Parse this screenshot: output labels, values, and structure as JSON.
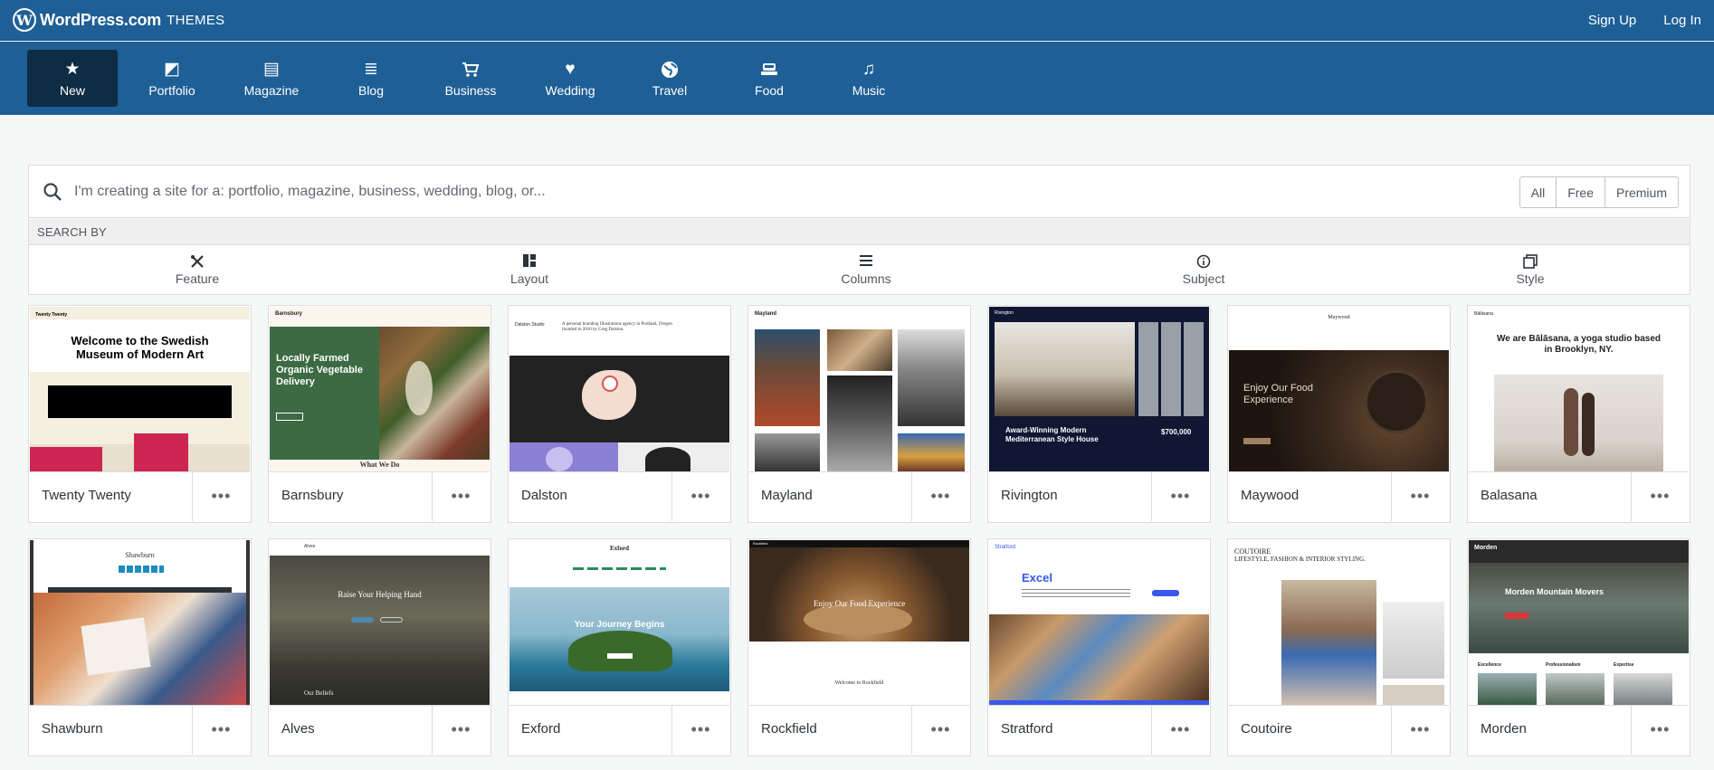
{
  "header": {
    "brand": "WordPress.com",
    "brand_sub": "THEMES",
    "logo_glyph": "W",
    "signup": "Sign Up",
    "login": "Log In"
  },
  "categories": [
    {
      "label": "New",
      "icon": "star-icon",
      "glyph": "★"
    },
    {
      "label": "Portfolio",
      "icon": "portfolio-icon",
      "glyph": "◩"
    },
    {
      "label": "Magazine",
      "icon": "magazine-icon",
      "glyph": "▤"
    },
    {
      "label": "Blog",
      "icon": "blog-icon",
      "glyph": "≣"
    },
    {
      "label": "Business",
      "icon": "cart-icon",
      "glyph": "🛒"
    },
    {
      "label": "Wedding",
      "icon": "heart-icon",
      "glyph": "♥"
    },
    {
      "label": "Travel",
      "icon": "globe-icon",
      "glyph": "◍"
    },
    {
      "label": "Food",
      "icon": "food-icon",
      "glyph": "⊟"
    },
    {
      "label": "Music",
      "icon": "music-icon",
      "glyph": "♫"
    }
  ],
  "search": {
    "placeholder": "I'm creating a site for a: portfolio, magazine, business, wedding, blog, or...",
    "filters": [
      "All",
      "Free",
      "Premium"
    ],
    "search_by_label": "SEARCH BY"
  },
  "facets": [
    {
      "label": "Feature",
      "icon": "tools-icon",
      "glyph": "✕"
    },
    {
      "label": "Layout",
      "icon": "layout-icon",
      "glyph": "▞"
    },
    {
      "label": "Columns",
      "icon": "columns-icon",
      "glyph": "≡"
    },
    {
      "label": "Subject",
      "icon": "info-icon",
      "glyph": "ⓘ"
    },
    {
      "label": "Style",
      "icon": "style-icon",
      "glyph": "⧉"
    }
  ],
  "themes": [
    {
      "name": "Twenty Twenty",
      "headline": "Welcome to the Swedish Museum of Modern Art",
      "site": "Twenty Twenty"
    },
    {
      "name": "Barnsbury",
      "headline": "Locally Farmed Organic Vegetable Delivery",
      "site": "Barnsbury",
      "sub": "What We Do"
    },
    {
      "name": "Dalston",
      "headline": "Dalston Studio",
      "intro": "A personal branding Illustrations agency in Portland, Oregon founded in 2010 by Greg Dalston."
    },
    {
      "name": "Mayland",
      "headline": "Mayland"
    },
    {
      "name": "Rivington",
      "headline": "Award-Winning Modern Mediterranean Style House",
      "price": "$700,000",
      "site": "Rivington"
    },
    {
      "name": "Maywood",
      "headline": "Enjoy Our Food Experience",
      "site": "Maywood"
    },
    {
      "name": "Balasana",
      "headline": "We are Bālāsana, a yoga studio based in Brooklyn, NY.",
      "site": "Bālāsana"
    },
    {
      "name": "Shawburn",
      "headline": "Shawburn"
    },
    {
      "name": "Alves",
      "headline": "Raise Your Helping Hand",
      "sub": "Our Beliefs",
      "site": "Alves"
    },
    {
      "name": "Exford",
      "headline": "Your Journey Begins",
      "site": "Exford"
    },
    {
      "name": "Rockfield",
      "headline": "Enjoy Our Food Experience",
      "sub": "Welcome to Rockfield",
      "site": "Rockfield"
    },
    {
      "name": "Stratford",
      "headline": "Excel",
      "site": "Stratford"
    },
    {
      "name": "Coutoire",
      "headline": "COUTOIRE",
      "sub": "LIFESTYLE, FASHION & INTERIOR STYLING."
    },
    {
      "name": "Morden",
      "headline": "Morden Mountain Movers",
      "site": "Morden",
      "cols": [
        "Excellence",
        "Professionalism",
        "Expertise"
      ]
    }
  ],
  "more_glyph": "•••",
  "colors": {
    "header_bg": "#1e5f96",
    "active_tab": "#0e2c44",
    "page_bg": "#f6f7f7"
  }
}
